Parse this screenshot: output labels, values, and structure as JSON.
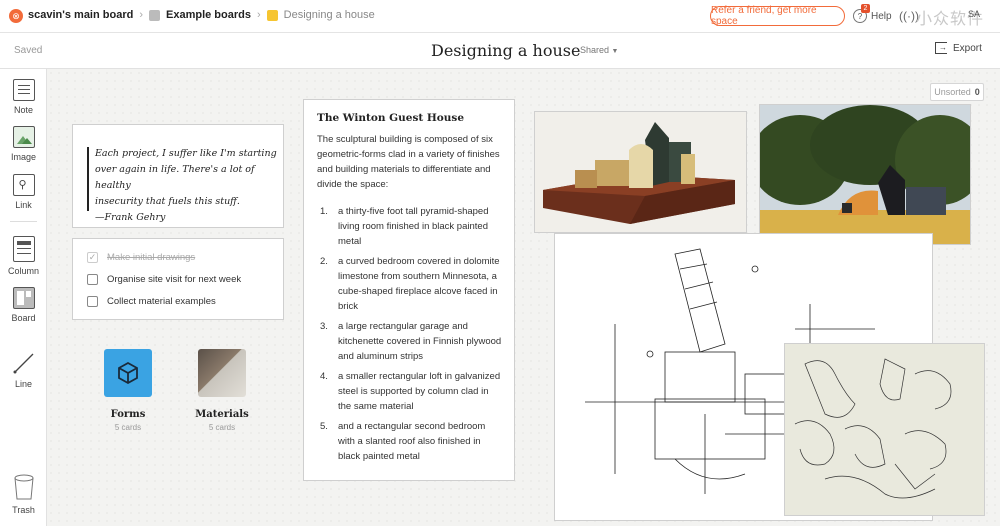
{
  "breadcrumb": {
    "root": "scavin's main board",
    "mid": "Example boards",
    "current": "Designing a house",
    "mid_color": "#bbbbbb",
    "current_color": "#f6c531"
  },
  "header": {
    "refer_label": "Refer a friend, get more space",
    "help_label": "Help",
    "help_badge": "2",
    "avatar": "SA",
    "watermark": "小众软件",
    "accent": "#f26b3a"
  },
  "subbar": {
    "saved": "Saved",
    "title": "Designing a house",
    "shared": "Shared",
    "export": "Export"
  },
  "tools": {
    "note": "Note",
    "image": "Image",
    "link": "Link",
    "column": "Column",
    "board": "Board",
    "line": "Line",
    "trash": "Trash"
  },
  "unsorted": {
    "label": "Unsorted",
    "count": "0"
  },
  "quote": {
    "text_lines": [
      "Each project, I suffer like I'm starting",
      "over again in life. There's a lot of healthy",
      "insecurity that fuels this stuff."
    ],
    "author": "—Frank Gehry"
  },
  "todo": {
    "items": [
      {
        "label": "Make initial drawings",
        "done": true
      },
      {
        "label": "Organise site visit for next week",
        "done": false
      },
      {
        "label": "Collect material examples",
        "done": false
      }
    ]
  },
  "boards": [
    {
      "name": "Forms",
      "count": "5 cards",
      "color": "#3aa3e3"
    },
    {
      "name": "Materials",
      "count": "5 cards"
    }
  ],
  "text_card": {
    "heading": "The Winton Guest House",
    "lead_lines": [
      "The sculptural building is composed of six",
      "geometric-forms clad in a variety of finishes",
      "and building materials to differentiate and",
      "divide the space:"
    ],
    "items": [
      {
        "n": "1.",
        "lines": [
          "a thirty-five foot tall pyramid-shaped",
          "living room finished in black painted",
          "metal"
        ]
      },
      {
        "n": "2.",
        "lines": [
          "a curved bedroom covered in dolomite",
          "limestone from southern Minnesota, a",
          "cube-shaped fireplace alcove faced in",
          "brick"
        ]
      },
      {
        "n": "3.",
        "lines": [
          "a large rectangular garage and",
          "kitchenette covered in Finnish plywood",
          "and aluminum strips"
        ]
      },
      {
        "n": "4.",
        "lines": [
          "a smaller rectangular loft in galvanized",
          "steel is supported by column clad in",
          "the same material"
        ]
      },
      {
        "n": "5.",
        "lines": [
          "and a rectangular second bedroom",
          "with a slanted roof also finished in",
          "black painted metal"
        ]
      }
    ]
  }
}
